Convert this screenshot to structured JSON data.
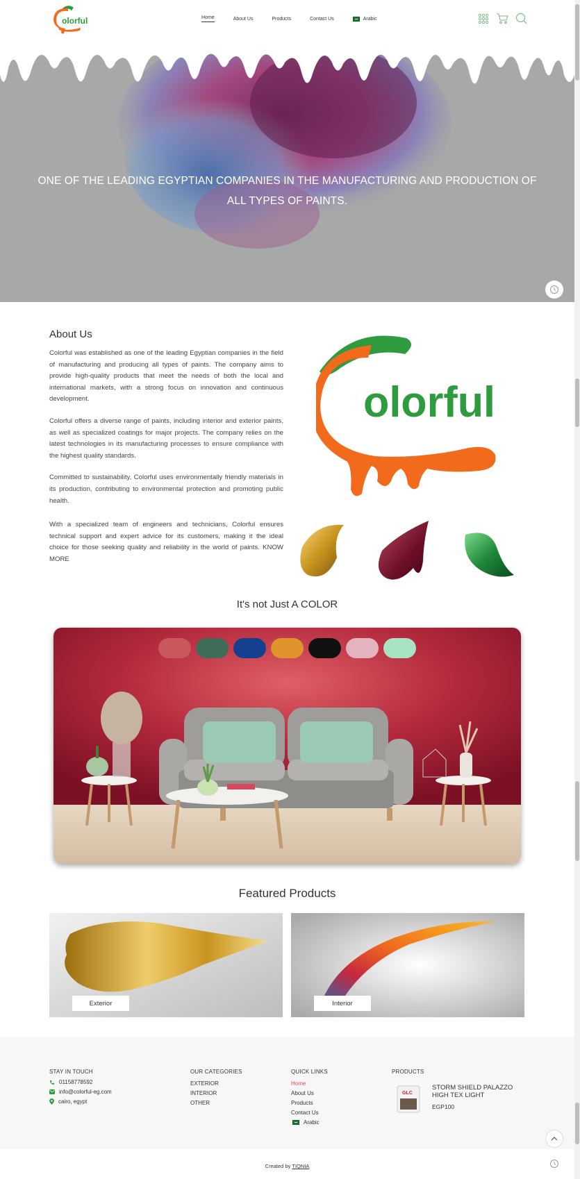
{
  "header": {
    "logo_text": "olorful",
    "nav": [
      {
        "label": "Home",
        "active": true
      },
      {
        "label": "About Us",
        "active": false
      },
      {
        "label": "Products",
        "active": false
      },
      {
        "label": "Contact Us",
        "active": false
      },
      {
        "label": "Arabic",
        "active": false
      }
    ]
  },
  "hero": {
    "text": "ONE OF THE LEADING EGYPTIAN COMPANIES IN THE MANUFACTURING AND PRODUCTION OF ALL TYPES OF PAINTS."
  },
  "about": {
    "title": "About Us",
    "paragraphs": [
      "Colorful was established as one of the leading Egyptian companies in the field of manufacturing and producing all types of paints. The company aims to provide high-quality products that meet the needs of both the local and international markets, with a strong focus on innovation and continuous development.",
      "Colorful offers a diverse range of paints, including interior and exterior paints, as well as specialized coatings for major projects. The company relies on the latest technologies in its manufacturing processes to ensure compliance with the highest quality standards.",
      "Committed to sustainability, Colorful uses environmentally friendly materials in its production, contributing to environmental protection and promoting public health.",
      "With a specialized team of engineers and technicians, Colorful ensures technical support and expert advice for its customers, making it the ideal choice for those seeking quality and reliability in the world of paints. KNOW MORE"
    ],
    "logo_text": "olorful"
  },
  "color_section": {
    "title": "It's not Just A COLOR",
    "chips": [
      "#c9575c",
      "#3f6d5a",
      "#153f8f",
      "#e0922c",
      "#111111",
      "#e3b4bd",
      "#a8e4c3"
    ]
  },
  "featured": {
    "title": "Featured Products",
    "items": [
      {
        "label": "Exterior"
      },
      {
        "label": "Interior"
      }
    ]
  },
  "footer": {
    "stay": {
      "heading": "STAY IN TOUCH",
      "phone": "01158778592",
      "email": "info@colorful-eg.com",
      "location": "cairo, egypt"
    },
    "categories": {
      "heading": "OUR CATEGORIES",
      "items": [
        "EXTERIOR",
        "INTERIOR",
        "OTHER"
      ]
    },
    "quick_links": {
      "heading": "QUICK LINKS",
      "items": [
        "Home",
        "About Us",
        "Products",
        "Contact Us",
        "Arabic"
      ]
    },
    "products": {
      "heading": "PRODUCTS",
      "badge": "GLC",
      "name": "STORM SHIELD PALAZZO HIGH TEX LIGHT",
      "price": "EGP100"
    },
    "credit_prefix": "Created by",
    "credit_link": "TIQNIA"
  },
  "colors": {
    "brand_green": "#2e9c3e",
    "brand_orange": "#f26a1b",
    "hero_gray": "#a6a9a8",
    "room_wall": "#a31f33",
    "link_highlight": "#e04b4b"
  }
}
